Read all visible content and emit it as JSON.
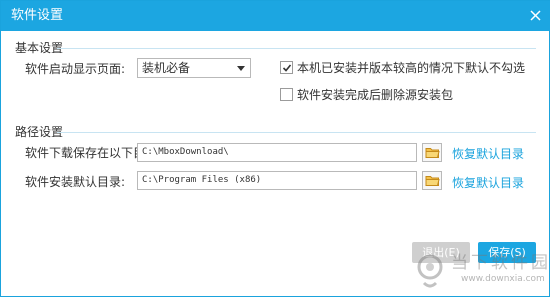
{
  "window": {
    "title": "软件设置",
    "close_icon": "close-icon"
  },
  "basic": {
    "section_title": "基本设置",
    "startup_label": "软件启动显示页面:",
    "startup_value": "装机必备",
    "checkbox1_label": "本机已安装并版本较高的情况下默认不勾选",
    "checkbox1_checked": true,
    "checkbox2_label": "软件安装完成后删除源安装包",
    "checkbox2_checked": false
  },
  "paths": {
    "section_title": "路径设置",
    "download_label": "软件下载保存在以下目录:",
    "download_value": "C:\\MboxDownload\\",
    "download_restore": "恢复默认目录",
    "install_label": "软件安装默认目录:",
    "install_value": "C:\\Program Files (x86)",
    "install_restore": "恢复默认目录",
    "folder_icon": "folder-icon"
  },
  "buttons": {
    "exit_label": "退出(E)",
    "save_label": "保存(S)"
  },
  "watermark": {
    "main": "当下软件园",
    "url": "www.downxia.com"
  },
  "colors": {
    "accent": "#1ca6e1",
    "link": "#1aa3dd",
    "exit_button": "#cfcfcf"
  }
}
